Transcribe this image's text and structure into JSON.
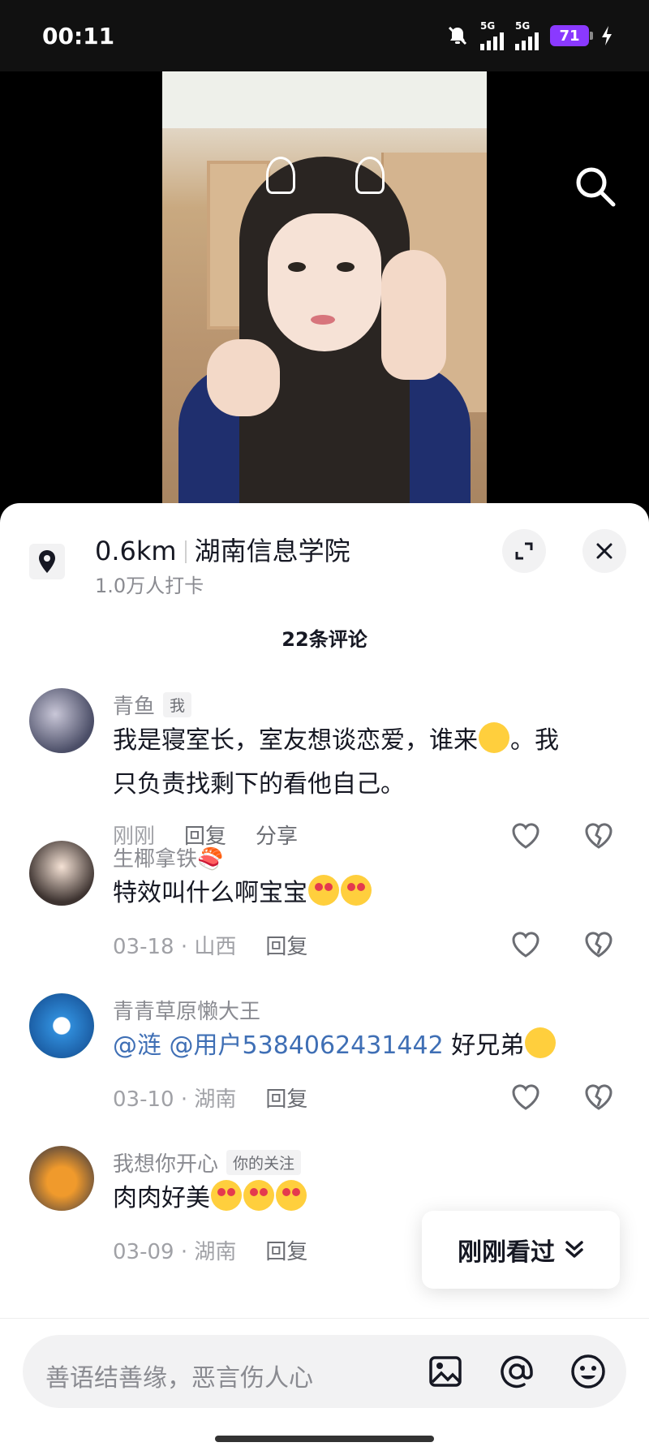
{
  "status": {
    "time": "00:11",
    "signal1": "5G",
    "signal2": "5G",
    "battery": "71"
  },
  "location": {
    "distance": "0.6km",
    "place": "湖南信息学院",
    "checkins": "1.0万人打卡"
  },
  "comments_count": "22条评论",
  "comments": [
    {
      "name": "青鱼",
      "tag": "我",
      "text1": "我是寝室长，室友想谈恋爱，谁来",
      "text1b": "。我",
      "text2": "只负责找剩下的看他自己。",
      "time": "刚刚",
      "reply": "回复",
      "share": "分享"
    },
    {
      "name": "生椰拿铁🍣",
      "text": "特效叫什么啊宝宝",
      "time": "03-18 · 山西",
      "reply": "回复"
    },
    {
      "name": "青青草原懒大王",
      "mention1": "@涟",
      "mention2": "@用户5384062431442",
      "text": " 好兄弟",
      "time": "03-10 · 湖南",
      "reply": "回复"
    },
    {
      "name": "我想你开心",
      "tag": "你的关注",
      "text": "肉肉好美",
      "time": "03-09 · 湖南",
      "reply": "回复"
    }
  ],
  "recent_button": "刚刚看过",
  "input": {
    "placeholder": "善语结善缘，恶言伤人心"
  }
}
